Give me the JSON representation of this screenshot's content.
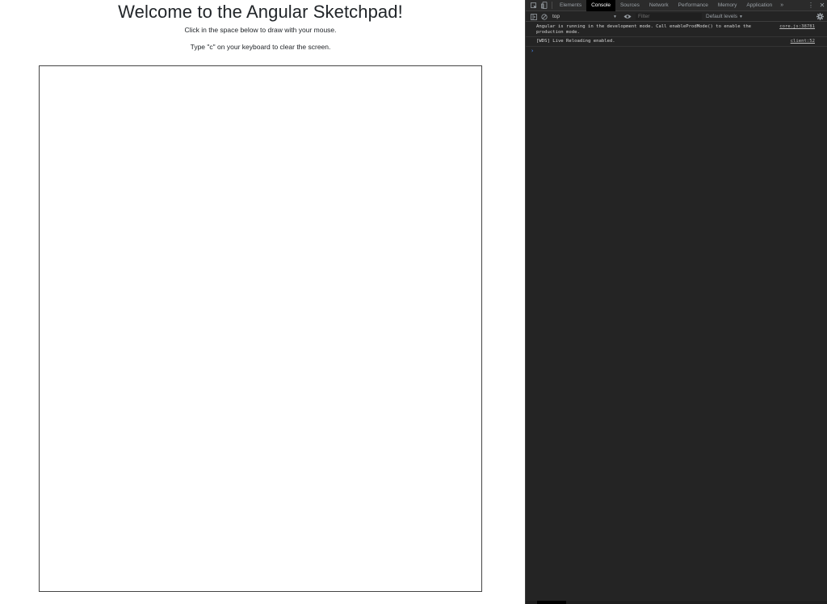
{
  "page": {
    "title": "Welcome to the Angular Sketchpad!",
    "instruction_draw": "Click in the space below to draw with your mouse.",
    "instruction_clear": "Type \"c\" on your keyboard to clear the screen."
  },
  "devtools": {
    "tabs": [
      {
        "label": "Elements",
        "active": false
      },
      {
        "label": "Console",
        "active": true
      },
      {
        "label": "Sources",
        "active": false
      },
      {
        "label": "Network",
        "active": false
      },
      {
        "label": "Performance",
        "active": false
      },
      {
        "label": "Memory",
        "active": false
      },
      {
        "label": "Application",
        "active": false
      }
    ],
    "more_tabs": "»",
    "toolbar": {
      "context": "top",
      "filter_placeholder": "Filter",
      "levels": "Default levels"
    },
    "messages": [
      {
        "text": "Angular is running in the development mode. Call enableProdMode() to enable the production mode.",
        "source": "core.js:38781"
      },
      {
        "text": "[WDS] Live Reloading enabled.",
        "source": "client:52"
      }
    ],
    "prompt": "›",
    "colors": {
      "panel_bg": "#242424",
      "active_tab_bg": "#000000",
      "prompt": "#4d90fe"
    },
    "icons": [
      "inspect-element-icon",
      "device-toggle-icon",
      "sidebar-toggle-icon",
      "clear-console-icon",
      "eye-icon",
      "gear-icon",
      "kebab-menu-icon",
      "close-icon"
    ]
  }
}
